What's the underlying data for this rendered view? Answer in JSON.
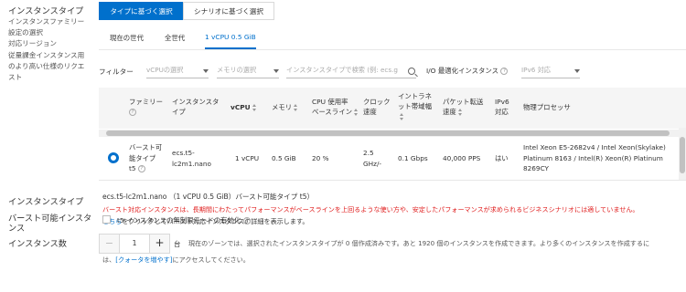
{
  "left": {
    "title": "インスタンスタイプ",
    "description_lines": [
      "インスタンスファミリー",
      "設定の選択",
      "対応リージョン",
      "従量課金インスタンス用",
      "のより高い仕様のリクエ",
      "スト"
    ]
  },
  "tabs": [
    {
      "label": "タイプに基づく選択",
      "active": true
    },
    {
      "label": "シナリオに基づく選択",
      "active": false
    }
  ],
  "subtabs": [
    {
      "label": "現在の世代",
      "active": false
    },
    {
      "label": "全世代",
      "active": false
    },
    {
      "label": "1 vCPU 0.5 GiB",
      "active": true
    }
  ],
  "filter": {
    "label": "フィルター",
    "vcpu_placeholder": "vCPUの選択",
    "memory_placeholder": "メモリの選択",
    "search_placeholder": "インスタンスタイプで検索 (例: ecs.g",
    "io_label": "I/O 最適化インスタンス",
    "ipv6_placeholder": "IPv6 対応"
  },
  "table": {
    "headers": {
      "family": "ファミリー",
      "instance_type_l1": "インスタンスタ",
      "instance_type_l2": "イプ",
      "vcpu": "vCPU",
      "memory": "メモリ",
      "cpu_baseline_l1": "CPU 使用率",
      "cpu_baseline_l2": "ベースライン",
      "clock_l1": "クロック",
      "clock_l2": "速度",
      "bandwidth_l1": "イントラネ",
      "bandwidth_l2": "ット帯域幅",
      "pps_l1": "パケット転送",
      "pps_l2": "速度",
      "ipv6_l1": "IPv6",
      "ipv6_l2": "対応",
      "processor": "物理プロセッサ"
    },
    "row": {
      "family_l1": "バースト可",
      "family_l2": "能タイプ",
      "family_l3": "t5",
      "type_l1": "ecs.t5-",
      "type_l2": "lc2m1.nano",
      "vcpu": "1 vCPU",
      "memory": "0.5 GiB",
      "cpu_baseline": "20 %",
      "clock_l1": "2.5",
      "clock_l2": "GHz/-",
      "bandwidth": "0.1 Gbps",
      "pps": "40,000 PPS",
      "ipv6": "はい",
      "processor_l1": "Intel Xeon E5-2682v4 / Intel Xeon(Skylake)",
      "processor_l2": "Platinum 8163 / Intel(R) Xeon(R) Platinum",
      "processor_l3": "8269CY"
    }
  },
  "selected": {
    "title": "インスタンスタイプ",
    "summary": "ecs.t5-lc2m1.nano （1 vCPU 0.5 GiB）バースト可能タイプ t5）",
    "warning": "バースト対応インスタンスは、長期間にわたってパフォーマンスがベースラインを上回るような使い方や、安定したパフォーマンスが求められるビジネスシナリオには適していません。",
    "link_text": "こちら",
    "link_suffix": "をクリックしてバースト対応インスタンスの詳細を表示します。"
  },
  "burst": {
    "title_l1": "バースト可能インスタ",
    "title_l2": "ンス",
    "checkbox_label": "t5 インスタンスの無制限モードの有効化"
  },
  "count": {
    "title": "インスタンス数",
    "minus": "−",
    "value": "1",
    "plus": "+",
    "unit": "台",
    "desc_l1": "現在のゾーンでは、選択されたインスタンスタイプが 0 個作成済みです。あと 1920 個のインスタンスを作成できます。より多くのインスタンスを作成するに",
    "desc_l2_prefix": "は、",
    "quota_link": "[クォータを増やす]",
    "desc_l2_suffix": "にアクセスしてください。"
  }
}
